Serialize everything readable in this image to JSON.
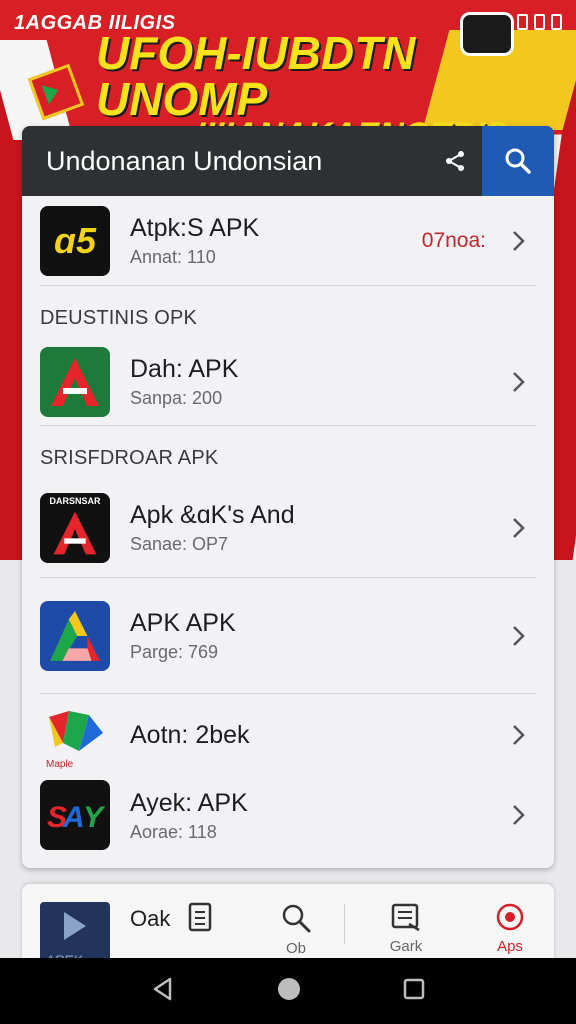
{
  "banner": {
    "top_small": "1AGGAB IILIGIS",
    "headline_line1": "UFOH-IUBDTN UNOMP",
    "headline_line2": "IIIIANAKAENOTBIS",
    "colors": {
      "red": "#d81f26",
      "yellow": "#f7e21b",
      "green": "#1ea74a"
    }
  },
  "search": {
    "value": "Undonanan Undonsian",
    "share_icon": "share-icon",
    "search_icon": "search-icon",
    "accent": "#1f5bb5"
  },
  "list": {
    "row1": {
      "title": "Atpk:S APK",
      "sub": "Annat: 110",
      "meta": "07noa:",
      "icon_text": "ɑ5"
    },
    "section1": "DEUSTINIS OPK",
    "row2": {
      "title": "Dah: APK",
      "sub": "Sanpa: 200"
    },
    "section2": "SRISFDROAR APK",
    "row3": {
      "title": "Apk  &ɑK's And",
      "sub": "Sanae: OP7",
      "icon_text": "DARSNSAR"
    },
    "row4": {
      "title": "APK APK",
      "sub": "Parge: 769"
    },
    "row5": {
      "title": "Aotn: 2bek",
      "icon_text": "Maple"
    },
    "row6": {
      "title": "Ayek: APK",
      "sub": "Aorae: 118"
    }
  },
  "bottom_nav": {
    "thumb_label": "APEK",
    "oak_label": "Oak",
    "items": [
      {
        "label": "Ob",
        "icon": "search-icon"
      },
      {
        "label": "Gark",
        "icon": "list-icon"
      },
      {
        "label": "Aps",
        "icon": "target-icon"
      }
    ],
    "active_color": "#d81f26"
  },
  "system_nav": {
    "back": "back-icon",
    "home": "home-icon",
    "recents": "recents-icon"
  }
}
